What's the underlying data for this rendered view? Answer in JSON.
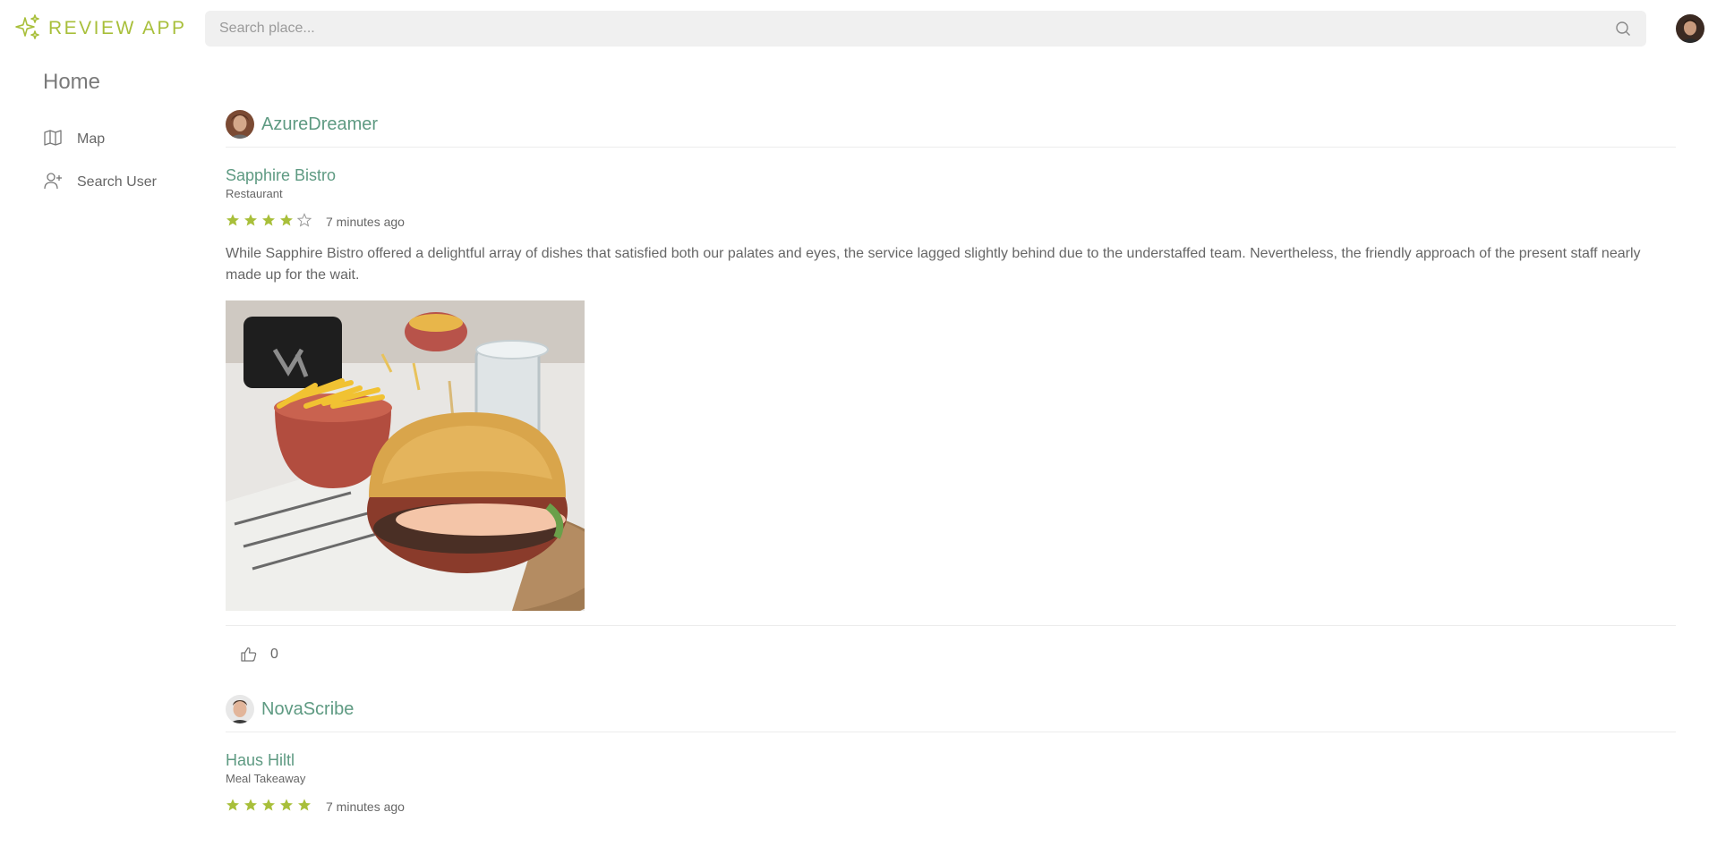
{
  "app": {
    "name": "REVIEW APP"
  },
  "search": {
    "placeholder": "Search place..."
  },
  "sidebar": {
    "title": "Home",
    "items": [
      {
        "label": "Map",
        "icon": "map-icon"
      },
      {
        "label": "Search User",
        "icon": "user-plus-icon"
      }
    ]
  },
  "colors": {
    "accent": "#a8bf3a",
    "link": "#5e9a82",
    "star": "#a8bf3a"
  },
  "reviews": [
    {
      "user": "AzureDreamer",
      "place": "Sapphire Bistro",
      "category": "Restaurant",
      "rating": 4,
      "max_rating": 5,
      "time": "7 minutes ago",
      "text": "While Sapphire Bistro offered a delightful array of dishes that satisfied both our palates and eyes, the service lagged slightly behind due to the understaffed team. Nevertheless, the friendly approach of the present staff nearly made up for the wait.",
      "likes": "0"
    },
    {
      "user": "NovaScribe",
      "place": "Haus Hiltl",
      "category": "Meal Takeaway",
      "rating": 5,
      "max_rating": 5,
      "time": "7 minutes ago"
    }
  ]
}
